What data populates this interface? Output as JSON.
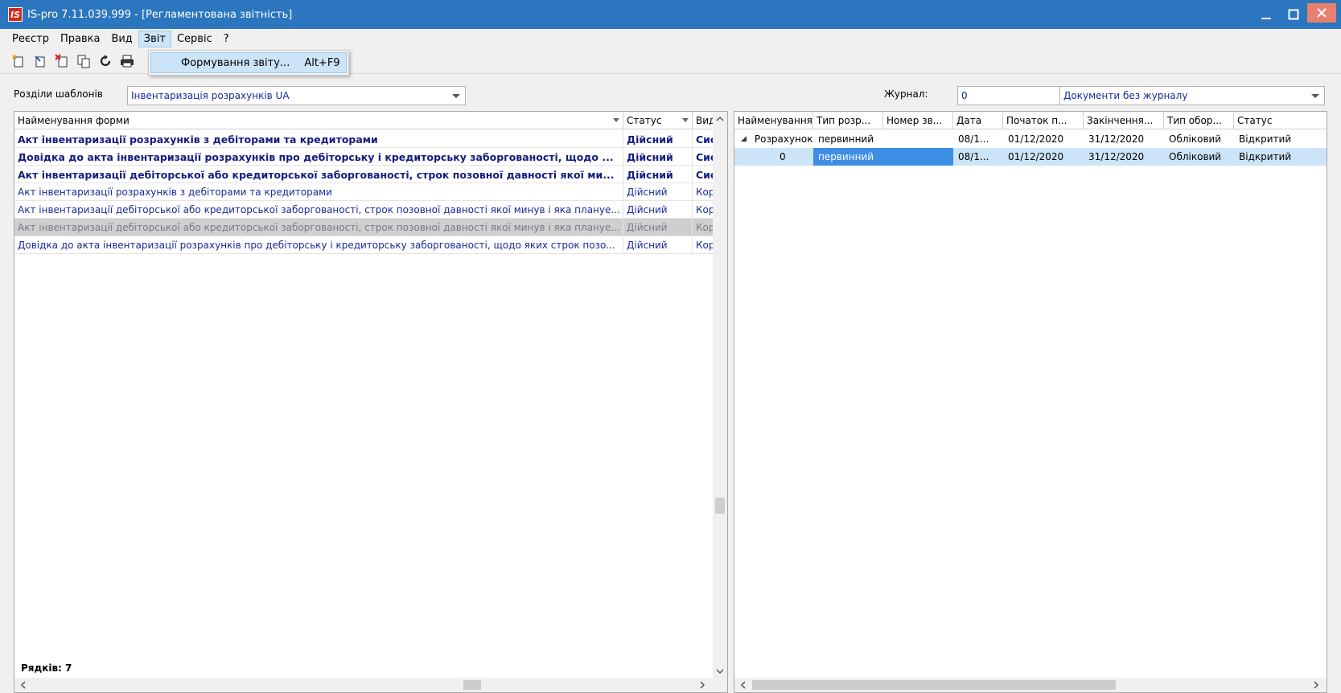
{
  "window": {
    "logo": "IS",
    "title": "IS-pro 7.11.039.999 - [Регламентована звітність]"
  },
  "menu": [
    "Реєстр",
    "Правка",
    "Вид",
    "Звіт",
    "Сервіс",
    "?"
  ],
  "toolbar_icons": [
    "new-doc-icon",
    "edit-doc-icon",
    "delete-doc-icon",
    "copy-doc-icon",
    "refresh-icon",
    "print-icon"
  ],
  "dropdown": {
    "item_label": "Формування звіту...",
    "item_shortcut": "Alt+F9"
  },
  "filters": {
    "sections_label": "Розділи шаблонів",
    "sections_value": "Інвентаризація розрахунків UA",
    "journal_label": "Журнал:",
    "journal_number": "0",
    "journal_value": "Документи без журналу"
  },
  "left_grid": {
    "columns": [
      "Найменування форми",
      "Статус",
      "Вид"
    ],
    "rows": [
      {
        "name": "Акт інвентаризації розрахунків з дебіторами та кредиторами",
        "status": "Дійсний",
        "kind": "Сис"
      },
      {
        "name": "Довідка до акта інвентаризації розрахунків про дебіторську і кредиторську заборгованості, щодо ...",
        "status": "Дійсний",
        "kind": "Сис"
      },
      {
        "name": "Акт інвентаризації дебіторської або кредиторської заборгованості, строк позовної давності якої ми...",
        "status": "Дійсний",
        "kind": "Сис"
      },
      {
        "name": "Акт інвентаризації розрахунків з дебіторами та кредиторами",
        "status": "Дійсний",
        "kind": "Кор"
      },
      {
        "name": "Акт інвентаризації дебіторської або кредиторської заборгованості, строк позовної давності якої минув і яка плануе...",
        "status": "Дійсний",
        "kind": "Кор"
      },
      {
        "name": "Акт інвентаризації дебіторської або кредиторської заборгованості, строк позовної давності якої минув і яка плануе...",
        "status": "Дійсний",
        "kind": "Кор"
      },
      {
        "name": "Довідка до акта інвентаризації розрахунків про дебіторську і кредиторську заборгованості, щодо яких строк позо...",
        "status": "Дійсний",
        "kind": "Кор"
      }
    ],
    "row_count_label": "Рядків: 7"
  },
  "right_grid": {
    "columns": [
      "Найменування",
      "Тип розр...",
      "Номер зв...",
      "Дата",
      "Початок п...",
      "Закінчення...",
      "Тип обор...",
      "Статус"
    ],
    "rows": [
      {
        "expander": "◢",
        "name": "Розрахунок",
        "type": "первинний",
        "number": "",
        "date": "08/1...",
        "start": "01/12/2020",
        "end": "31/12/2020",
        "turnover": "Обліковий",
        "status": "Відкритий"
      },
      {
        "expander": "",
        "name": "0",
        "type": "первинний",
        "number": "",
        "date": "08/1...",
        "start": "01/12/2020",
        "end": "31/12/2020",
        "turnover": "Обліковий",
        "status": "Відкритий"
      }
    ]
  }
}
